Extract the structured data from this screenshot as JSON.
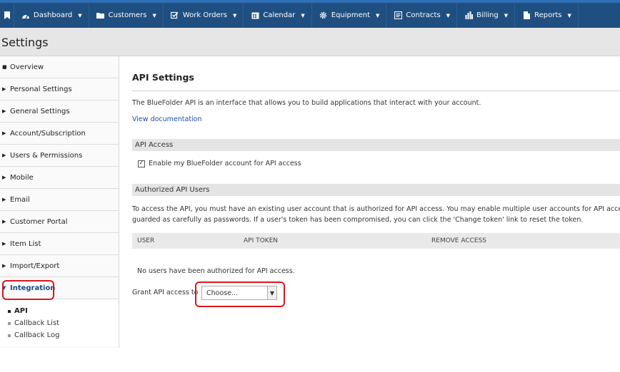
{
  "nav": {
    "items": [
      {
        "label": "Dashboard",
        "icon": "dashboard-icon"
      },
      {
        "label": "Customers",
        "icon": "folder-icon"
      },
      {
        "label": "Work Orders",
        "icon": "checkbox-icon"
      },
      {
        "label": "Calendar",
        "icon": "calendar-icon"
      },
      {
        "label": "Equipment",
        "icon": "gear-icon"
      },
      {
        "label": "Contracts",
        "icon": "contract-icon"
      },
      {
        "label": "Billing",
        "icon": "bar-chart-icon"
      },
      {
        "label": "Reports",
        "icon": "document-icon"
      }
    ]
  },
  "page": {
    "title": "Settings"
  },
  "sidebar": {
    "items": [
      {
        "label": "Overview"
      },
      {
        "label": "Personal Settings"
      },
      {
        "label": "General Settings"
      },
      {
        "label": "Account/Subscription"
      },
      {
        "label": "Users & Permissions"
      },
      {
        "label": "Mobile"
      },
      {
        "label": "Email"
      },
      {
        "label": "Customer Portal"
      },
      {
        "label": "Item List"
      },
      {
        "label": "Import/Export"
      },
      {
        "label": "Integration"
      }
    ],
    "subitems": [
      {
        "label": "API"
      },
      {
        "label": "Callback List"
      },
      {
        "label": "Callback Log"
      }
    ]
  },
  "main": {
    "heading": "API Settings",
    "intro": "The BlueFolder API is an interface that allows you to build applications that interact with your account.",
    "doc_link": "View documentation",
    "access_section": "API Access",
    "enable_label": "Enable my BlueFolder account for API access",
    "enable_checked": true,
    "users_section": "Authorized API Users",
    "description_line1": "To access the API, you must have an existing user account that is authorized for API access. You may enable multiple user accounts for API access. Each",
    "description_line2": "guarded as carefully as passwords. If a user's token has been compromised, you can click the 'Change token' link to reset the token.",
    "columns": [
      "USER",
      "API TOKEN",
      "REMOVE ACCESS"
    ],
    "empty_message": "No users have been authorized for API access.",
    "grant_label": "Grant API access to",
    "grant_select_value": "Choose..."
  },
  "colors": {
    "nav_bg": "#1f4f80",
    "top_strip": "#2f6fb5",
    "link": "#1a4fa8",
    "highlight_ring": "#e0141e"
  }
}
